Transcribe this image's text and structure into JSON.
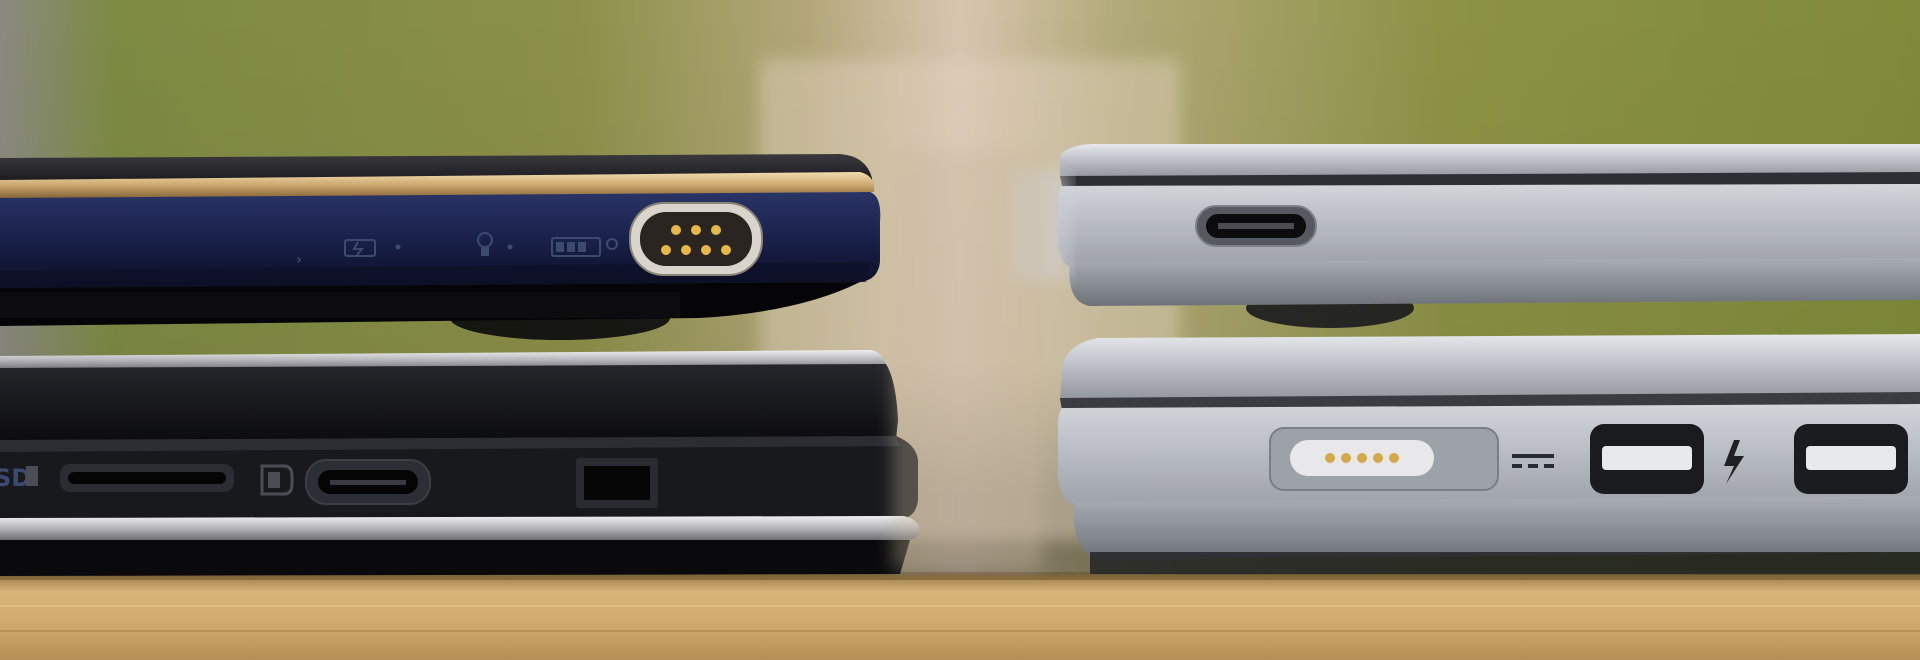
{
  "scene": {
    "left_laptops": {
      "top_device": {
        "color": "#1a2140",
        "trim_color": "#c8a878",
        "icons": [
          "chevron-mark",
          "battery-charge-icon",
          "bulb-icon",
          "battery-level-icon",
          "magnetic-charging-port"
        ]
      },
      "bottom_device": {
        "color": "#16171c",
        "trim_color": "#c9c9cc",
        "sd_label": "SD",
        "icons": [
          "sd-card-slot",
          "displayport-icon",
          "usb-c-port",
          "lock-slot"
        ]
      }
    },
    "right_laptops": {
      "top_device": {
        "color": "#b9bdc4",
        "icons": [
          "usb-c-port"
        ]
      },
      "bottom_device": {
        "color": "#b6bac1",
        "icons": [
          "magsafe-port",
          "dc-power-icon",
          "thunderbolt-port",
          "thunderbolt-icon",
          "thunderbolt-port"
        ]
      }
    },
    "background_color": "#7a8a3e",
    "table_color": "#c8a46a"
  }
}
